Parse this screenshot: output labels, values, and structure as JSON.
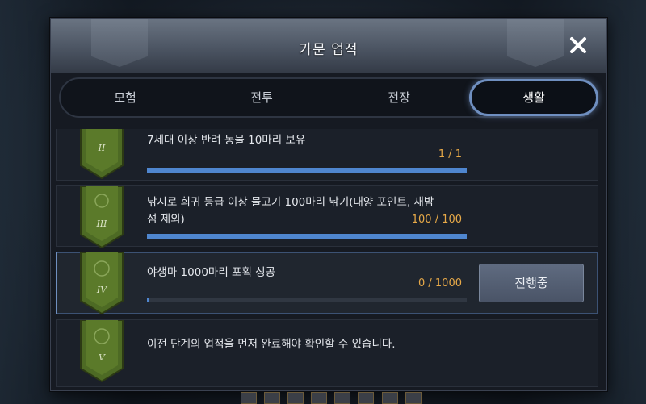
{
  "dialog": {
    "title": "가문 업적"
  },
  "tabs": [
    {
      "label": "모험",
      "active": false
    },
    {
      "label": "전투",
      "active": false
    },
    {
      "label": "전장",
      "active": false
    },
    {
      "label": "생활",
      "active": true
    }
  ],
  "achievements": [
    {
      "tier": "II",
      "text": "7세대 이상 반려 동물 10마리 보유",
      "count": "1 / 1",
      "progress": 1.0,
      "status": null
    },
    {
      "tier": "III",
      "text": "낚시로 희귀 등급 이상 물고기 100마리 낚기(대양 포인트, 새밤 섬 제외)",
      "count": "100 / 100",
      "progress": 1.0,
      "status": null
    },
    {
      "tier": "IV",
      "text": "야생마 1000마리 포획 성공",
      "count": "0 / 1000",
      "progress": 0.0,
      "status": "진행중"
    },
    {
      "tier": "V",
      "text": "이전 단계의 업적을 먼저 완료해야 확인할 수 있습니다.",
      "count": null,
      "progress": null,
      "status": null
    }
  ],
  "colors": {
    "accent": "#6f8fc0",
    "progress_fill": "#4f86cf",
    "count_text": "#e7a948",
    "badge_green": "#5b7a2a"
  },
  "icons": [
    "close-icon",
    "tier-badge-icon"
  ]
}
